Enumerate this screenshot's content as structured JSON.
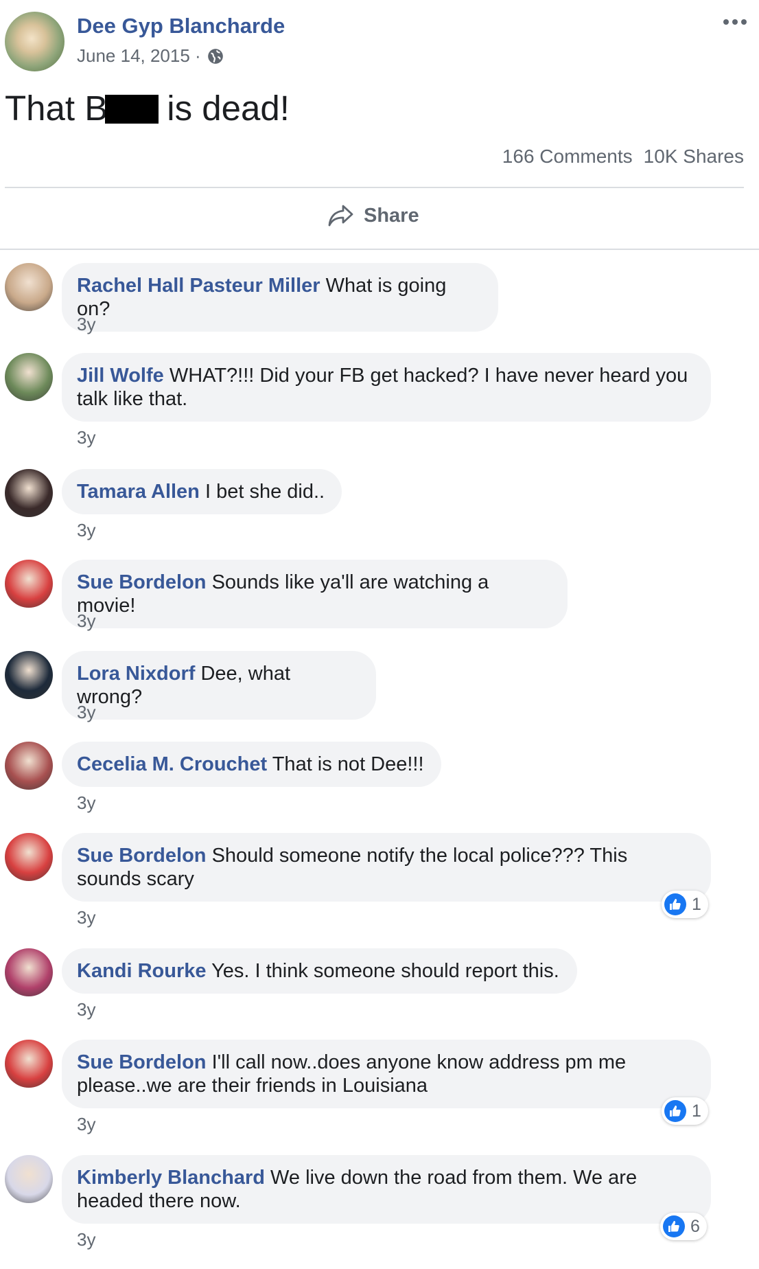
{
  "post": {
    "author": "Dee Gyp Blancharde",
    "date": "June 14, 2015 ·",
    "text_before": "That B",
    "text_after": "is dead!",
    "comments_count": "166 Comments",
    "shares_count": "10K Shares",
    "share_label": "Share"
  },
  "comments": [
    {
      "name": "Rachel Hall Pasteur Miller",
      "text": " What is going on?",
      "age": "3y",
      "avatar": "#c9a98a"
    },
    {
      "name": "Jill Wolfe",
      "text": " WHAT?!!! Did your FB get hacked? I have never heard you talk like that.",
      "age": "3y",
      "avatar": "#6d8a5a"
    },
    {
      "name": "Tamara Allen",
      "text": " I bet she did..",
      "age": "3y",
      "avatar": "#3a2a2a"
    },
    {
      "name": "Sue Bordelon",
      "text": " Sounds like ya'll are watching a movie!",
      "age": "3y",
      "avatar": "#d84040"
    },
    {
      "name": "Lora Nixdorf",
      "text": " Dee, what wrong?",
      "age": "3y",
      "avatar": "#1d2a3a"
    },
    {
      "name": "Cecelia M. Crouchet",
      "text": " That is not Dee!!!",
      "age": "3y",
      "avatar": "#a85050"
    },
    {
      "name": "Sue Bordelon",
      "text": " Should someone notify the local police??? This sounds scary",
      "age": "3y",
      "avatar": "#d84040",
      "likes": "1"
    },
    {
      "name": "Kandi Rourke",
      "text": " Yes. I think someone should report this.",
      "age": "3y",
      "avatar": "#b0406a"
    },
    {
      "name": "Sue Bordelon",
      "text": " I'll call now..does anyone know address pm me please..we are their friends in Louisiana",
      "age": "3y",
      "avatar": "#d84040",
      "likes": "1"
    },
    {
      "name": "Kimberly Blanchard",
      "text": " We live down the road from them. We are headed there now.",
      "age": "3y",
      "avatar": "#d8d8e8",
      "likes": "6"
    }
  ]
}
